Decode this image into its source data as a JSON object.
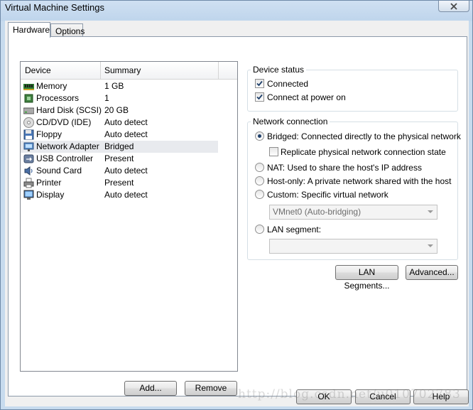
{
  "window": {
    "title": "Virtual Machine Settings"
  },
  "tabs": [
    {
      "label": "Hardware",
      "active": true
    },
    {
      "label": "Options",
      "active": false
    }
  ],
  "device_list": {
    "columns": [
      "Device",
      "Summary"
    ],
    "rows": [
      {
        "icon": "memory-icon",
        "device": "Memory",
        "summary": "1 GB",
        "selected": false
      },
      {
        "icon": "processor-icon",
        "device": "Processors",
        "summary": "1",
        "selected": false
      },
      {
        "icon": "hard-disk-icon",
        "device": "Hard Disk (SCSI)",
        "summary": "20 GB",
        "selected": false
      },
      {
        "icon": "cd-dvd-icon",
        "device": "CD/DVD (IDE)",
        "summary": "Auto detect",
        "selected": false
      },
      {
        "icon": "floppy-icon",
        "device": "Floppy",
        "summary": "Auto detect",
        "selected": false
      },
      {
        "icon": "network-adapter-icon",
        "device": "Network Adapter",
        "summary": "Bridged",
        "selected": true
      },
      {
        "icon": "usb-controller-icon",
        "device": "USB Controller",
        "summary": "Present",
        "selected": false
      },
      {
        "icon": "sound-card-icon",
        "device": "Sound Card",
        "summary": "Auto detect",
        "selected": false
      },
      {
        "icon": "printer-icon",
        "device": "Printer",
        "summary": "Present",
        "selected": false
      },
      {
        "icon": "display-icon",
        "device": "Display",
        "summary": "Auto detect",
        "selected": false
      }
    ]
  },
  "list_buttons": {
    "add": "Add...",
    "remove": "Remove"
  },
  "device_status": {
    "title": "Device status",
    "connected": {
      "label": "Connected",
      "checked": true
    },
    "connect_at_power_on": {
      "label": "Connect at power on",
      "checked": true
    }
  },
  "network_connection": {
    "title": "Network connection",
    "bridged": {
      "label": "Bridged: Connected directly to the physical network",
      "selected": true
    },
    "replicate": {
      "label": "Replicate physical network connection state",
      "checked": false
    },
    "nat": {
      "label": "NAT: Used to share the host's IP address",
      "selected": false
    },
    "host_only": {
      "label": "Host-only: A private network shared with the host",
      "selected": false
    },
    "custom": {
      "label": "Custom: Specific virtual network",
      "selected": false
    },
    "custom_network_value": "VMnet0 (Auto-bridging)",
    "lan_segment": {
      "label": "LAN segment:",
      "selected": false
    },
    "lan_segment_value": ""
  },
  "network_buttons": {
    "lan_segments": "LAN Segments...",
    "advanced": "Advanced..."
  },
  "dialog_buttons": {
    "ok": "OK",
    "cancel": "Cancel",
    "help": "Help"
  },
  "watermark": "http://blog.csdn.net/u010702783",
  "colors": {
    "selection": "#e8eaee",
    "radio_dot": "#1e3f6a",
    "window_frame": "#c7dbee"
  }
}
